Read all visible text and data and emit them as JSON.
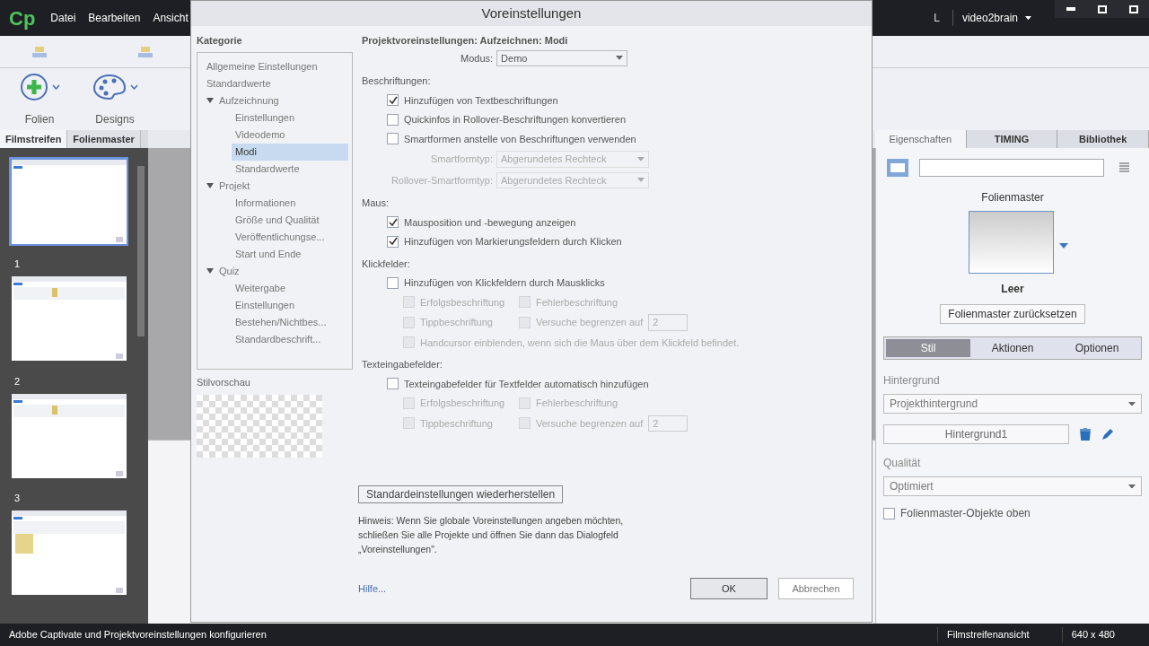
{
  "menu": [
    "Datei",
    "Bearbeiten",
    "Ansicht"
  ],
  "logo": "Cp",
  "nav": {
    "mode": "L",
    "account": "video2brain"
  },
  "toolbar": [
    {
      "label": "Folien",
      "kind": "plus"
    },
    {
      "label": "Designs",
      "kind": "palette"
    }
  ],
  "left_tabs": [
    {
      "label": "Filmstreifen",
      "selected": true
    },
    {
      "label": "Folienmaster",
      "selected": false
    }
  ],
  "right_tabs": [
    {
      "label": "Eigenschaften",
      "selected": true
    },
    {
      "label": "TIMING",
      "selected": false
    },
    {
      "label": "Bibliothek",
      "selected": false
    }
  ],
  "filmstrip": [
    {
      "number": "1",
      "selected": true,
      "kind": "blank"
    },
    {
      "number": "2",
      "selected": false,
      "kind": "ribbon"
    },
    {
      "number": "3",
      "selected": false,
      "kind": "ribbon"
    },
    {
      "selected": false,
      "kind": "folder"
    }
  ],
  "properties": {
    "master_label": "Folienmaster",
    "master_name": "Leer",
    "reset": "Folienmaster zurücksetzen",
    "subtabs": [
      {
        "label": "Stil",
        "selected": true
      },
      {
        "label": "Aktionen",
        "selected": false
      },
      {
        "label": "Optionen",
        "selected": false
      }
    ],
    "bg_label": "Hintergrund",
    "bg_value": "Projekthintergrund",
    "bg_button": "Hintergrund1",
    "quality_label": "Qualität",
    "quality_value": "Optimiert",
    "on_top": {
      "label": "Folienmaster-Objekte oben",
      "checked": false
    }
  },
  "status": {
    "text": "Adobe Captivate und Projektvoreinstellungen konfigurieren",
    "view": "Filmstreifenansicht",
    "size": "640 x 480"
  },
  "dialog": {
    "title": "Voreinstellungen",
    "category_label": "Kategorie",
    "tree": [
      {
        "label": "Allgemeine Einstellungen",
        "selected": false
      },
      {
        "label": "Standardwerte",
        "selected": false
      },
      {
        "label": "Aufzeichnung",
        "selected": false,
        "expanded": true,
        "children": [
          {
            "label": "Einstellungen",
            "selected": false
          },
          {
            "label": "Videodemo",
            "selected": false
          },
          {
            "label": "Modi",
            "selected": true
          },
          {
            "label": "Standardwerte",
            "selected": false
          }
        ]
      },
      {
        "label": "Projekt",
        "selected": false,
        "expanded": true,
        "children": [
          {
            "label": "Informationen",
            "selected": false
          },
          {
            "label": "Größe und Qualität",
            "selected": false
          },
          {
            "label": "Veröffentlichungse...",
            "selected": false
          },
          {
            "label": "Start und Ende",
            "selected": false
          }
        ]
      },
      {
        "label": "Quiz",
        "selected": false,
        "expanded": true,
        "children": [
          {
            "label": "Weitergabe",
            "selected": false
          },
          {
            "label": "Einstellungen",
            "selected": false
          },
          {
            "label": "Bestehen/Nichtbes...",
            "selected": false
          },
          {
            "label": "Standardbeschrift...",
            "selected": false
          }
        ]
      }
    ],
    "preview_label": "Stilvorschau",
    "heading": "Projektvoreinstellungen: Aufzeichnen: Modi",
    "mode_label": "Modus:",
    "mode_value": "Demo",
    "sections": [
      {
        "title": "Beschriftungen:",
        "items": [
          {
            "kind": "check",
            "label": "Hinzufügen von Textbeschriftungen",
            "checked": true,
            "disabled": false
          },
          {
            "kind": "check",
            "label": "Quickinfos in Rollover-Beschriftungen konvertieren",
            "checked": false,
            "disabled": false
          },
          {
            "kind": "check",
            "label": "Smartformen anstelle von Beschriftungen verwenden",
            "checked": false,
            "disabled": false
          },
          {
            "kind": "select",
            "label": "Smartformtyp:",
            "value": "Abgerundetes Rechteck",
            "disabled": true
          },
          {
            "kind": "select",
            "label": "Rollover-Smartformtyp:",
            "value": "Abgerundetes Rechteck",
            "disabled": true
          }
        ]
      },
      {
        "title": "Maus:",
        "items": [
          {
            "kind": "check",
            "label": "Mausposition und -bewegung anzeigen",
            "checked": true,
            "disabled": false
          },
          {
            "kind": "check",
            "label": "Hinzufügen von Markierungsfeldern durch Klicken",
            "checked": true,
            "disabled": false
          }
        ]
      },
      {
        "title": "Klickfelder:",
        "items": [
          {
            "kind": "check",
            "label": "Hinzufügen von Klickfeldern durch Mausklicks",
            "checked": false,
            "disabled": false
          },
          {
            "kind": "pair",
            "a": "Erfolgsbeschriftung",
            "b": "Fehlerbeschriftung",
            "disabled": true
          },
          {
            "kind": "limit",
            "a": "Tippbeschriftung",
            "b": "Versuche begrenzen auf",
            "value": "2",
            "disabled": true
          },
          {
            "kind": "sub",
            "label": "Handcursor einblenden, wenn sich die Maus über dem Klickfeld befindet.",
            "disabled": true
          }
        ]
      },
      {
        "title": "Texteingabefelder:",
        "items": [
          {
            "kind": "check",
            "label": "Texteingabefelder für Textfelder automatisch hinzufügen",
            "checked": false,
            "disabled": false
          },
          {
            "kind": "pair",
            "a": "Erfolgsbeschriftung",
            "b": "Fehlerbeschriftung",
            "disabled": true
          },
          {
            "kind": "limit",
            "a": "Tippbeschriftung",
            "b": "Versuche begrenzen auf",
            "value": "2",
            "disabled": true
          }
        ]
      }
    ],
    "restore": "Standardeinstellungen wiederherstellen",
    "hint": "Hinweis: Wenn Sie globale Voreinstellungen angeben möchten, schließen Sie alle Projekte und öffnen Sie dann das Dialogfeld „Voreinstellungen\".",
    "help": "Hilfe...",
    "ok": "OK",
    "cancel": "Abbrechen"
  }
}
